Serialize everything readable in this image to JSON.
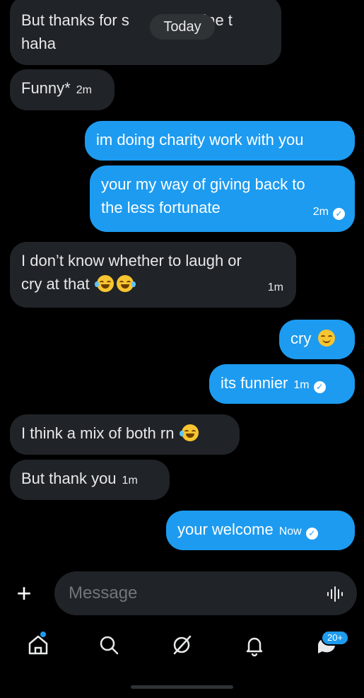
{
  "header": {
    "date_separator": "Today"
  },
  "messages": [
    {
      "side": "in",
      "text": "But thanks for saying i'm fine t haha",
      "line1": "But thanks for s",
      "line1b": "n fine t",
      "line2": "haha"
    },
    {
      "side": "in",
      "text": "Funny*",
      "time": "2m"
    },
    {
      "side": "out",
      "text": "im doing charity work with you"
    },
    {
      "side": "out",
      "line1": "your my way of giving back to",
      "line2": "the less fortunate",
      "time": "2m",
      "status": "read"
    },
    {
      "side": "in",
      "line1": "I don’t know whether to laugh or",
      "line2": "cry at that",
      "emoji": [
        "face-with-tears-of-joy",
        "face-with-tears-of-joy"
      ],
      "time": "1m"
    },
    {
      "side": "out",
      "text": "cry",
      "emoji": [
        "smiling-face-with-blush"
      ]
    },
    {
      "side": "out",
      "text": "its funnier",
      "time": "1m",
      "status": "read"
    },
    {
      "side": "in",
      "text": "I think a mix of both rn",
      "emoji": [
        "face-with-tears-of-joy"
      ]
    },
    {
      "side": "in",
      "text": "But thank you",
      "time": "1m"
    },
    {
      "side": "out",
      "text": "your welcome",
      "time": "Now",
      "status": "read"
    }
  ],
  "composer": {
    "placeholder": "Message",
    "add_icon": "plus-icon",
    "voice_icon": "voice-waveform-icon"
  },
  "tabbar": {
    "items": [
      {
        "name": "home",
        "icon": "home-icon",
        "has_dot": true
      },
      {
        "name": "search",
        "icon": "search-icon"
      },
      {
        "name": "grok",
        "icon": "grok-icon"
      },
      {
        "name": "notifications",
        "icon": "bell-icon"
      },
      {
        "name": "messages",
        "icon": "messages-icon",
        "badge": "20+"
      }
    ]
  },
  "colors": {
    "background": "#000000",
    "incoming": "#202327",
    "outgoing": "#1d9bf0",
    "muted": "#71767b"
  }
}
